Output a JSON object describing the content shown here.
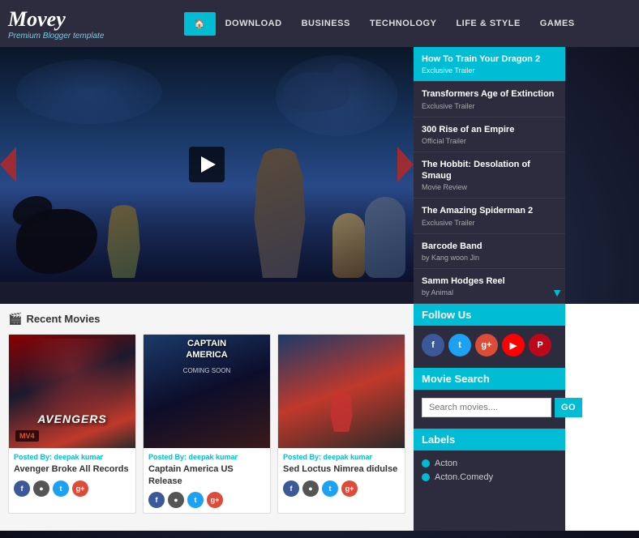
{
  "header": {
    "logo_title": "Movey",
    "logo_subtitle": "Premium Blogger template",
    "nav": {
      "home_icon": "🏠",
      "items": [
        {
          "label": "DOWNLOAD",
          "active": false
        },
        {
          "label": "BUSINESS",
          "active": false
        },
        {
          "label": "TECHNOLOGY",
          "active": false
        },
        {
          "label": "LIFE & STYLE",
          "active": false
        },
        {
          "label": "GAMES",
          "active": false
        }
      ]
    }
  },
  "sidebar": {
    "items": [
      {
        "title": "How To Train Your Dragon 2",
        "sub": "Exclusive Trailer",
        "active": true
      },
      {
        "title": "Transformers Age of Extinction",
        "sub": "Exclusive Trailer",
        "active": false
      },
      {
        "title": "300 Rise of an Empire",
        "sub": "Official Trailer",
        "active": false
      },
      {
        "title": "The Hobbit: Desolation of Smaug",
        "sub": "Movie Review",
        "active": false
      },
      {
        "title": "The Amazing Spiderman 2",
        "sub": "Exclusive Trailer",
        "active": false
      },
      {
        "title": "Barcode Band",
        "sub": "by Kang woon Jin",
        "active": false
      },
      {
        "title": "Samm Hodges Reel",
        "sub": "by Animal",
        "active": false
      }
    ],
    "scroll_indicator": "▼"
  },
  "hero": {
    "play_button_label": "▶"
  },
  "recent_movies": {
    "section_title": "Recent Movies",
    "section_icon": "🎬",
    "movies": [
      {
        "logo": "AVENGERS",
        "badge": "MV4",
        "posted_label": "Posted By:",
        "posted_by": "deepak kumar",
        "title": "Avenger Broke All Records",
        "social": [
          "f",
          "●",
          "t",
          "g+"
        ]
      },
      {
        "logo": "CAPTAIN\nAMERICA",
        "subtitle": "COMING SOON",
        "posted_label": "Posted By:",
        "posted_by": "deepak kumar",
        "title": "Captain America US Release",
        "social": [
          "f",
          "●",
          "t",
          "g+"
        ]
      },
      {
        "logo": "",
        "posted_label": "Posted By:",
        "posted_by": "deepak kumar",
        "title": "Sed Loctus Nimrea didulse",
        "social": [
          "f",
          "●",
          "t",
          "g+"
        ]
      }
    ]
  },
  "right_sidebar": {
    "follow_us": {
      "title": "Follow Us",
      "icons": [
        {
          "platform": "fb",
          "label": "f"
        },
        {
          "platform": "tw",
          "label": "t"
        },
        {
          "platform": "gp",
          "label": "g+"
        },
        {
          "platform": "yt",
          "label": "▶"
        },
        {
          "platform": "pi",
          "label": "P"
        }
      ]
    },
    "movie_search": {
      "title": "Movie Search",
      "placeholder": "Search movies....",
      "button_label": "GO"
    },
    "labels": {
      "title": "Labels",
      "items": [
        {
          "text": "Acton"
        },
        {
          "text": "Acton.Comedy"
        }
      ]
    }
  }
}
